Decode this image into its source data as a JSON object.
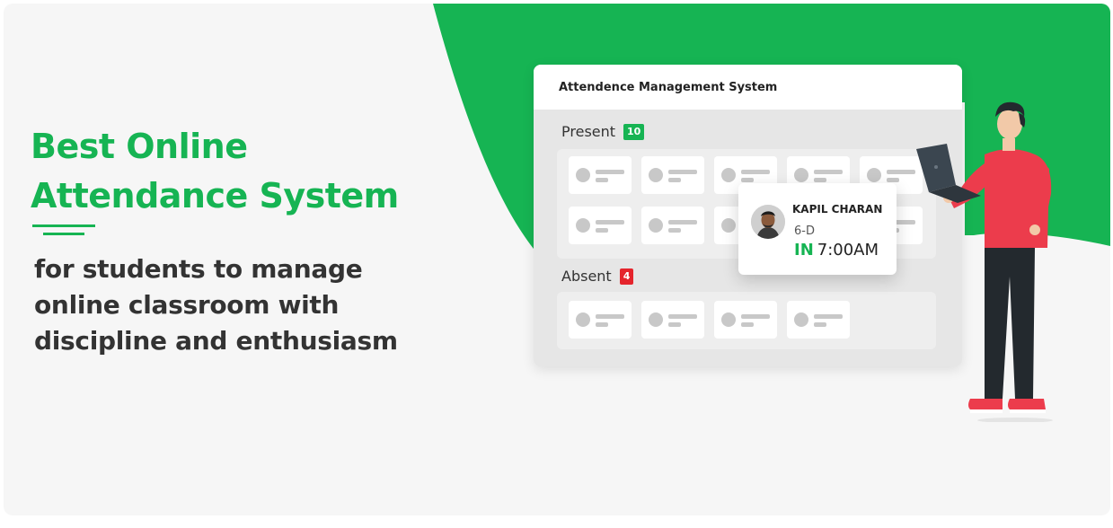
{
  "headline": {
    "line1": "Best Online",
    "line2": "Attendance System"
  },
  "subtext": {
    "line1": "for students to manage",
    "line2": "online classroom with",
    "line3": "discipline and enthusiasm"
  },
  "window": {
    "title": "Attendence Management System",
    "present": {
      "label": "Present",
      "count": "10",
      "cards": 10
    },
    "absent": {
      "label": "Absent",
      "count": "4",
      "cards": 4
    }
  },
  "popup": {
    "name": "KAPIL CHARAN",
    "class": "6-D",
    "status": "IN",
    "time": "7:00AM"
  },
  "colors": {
    "brand_green": "#16b453",
    "absent_red": "#e5242c",
    "present_green": "#16b453",
    "heading_dark": "#333333",
    "shirt_red": "#ec3c4c"
  }
}
